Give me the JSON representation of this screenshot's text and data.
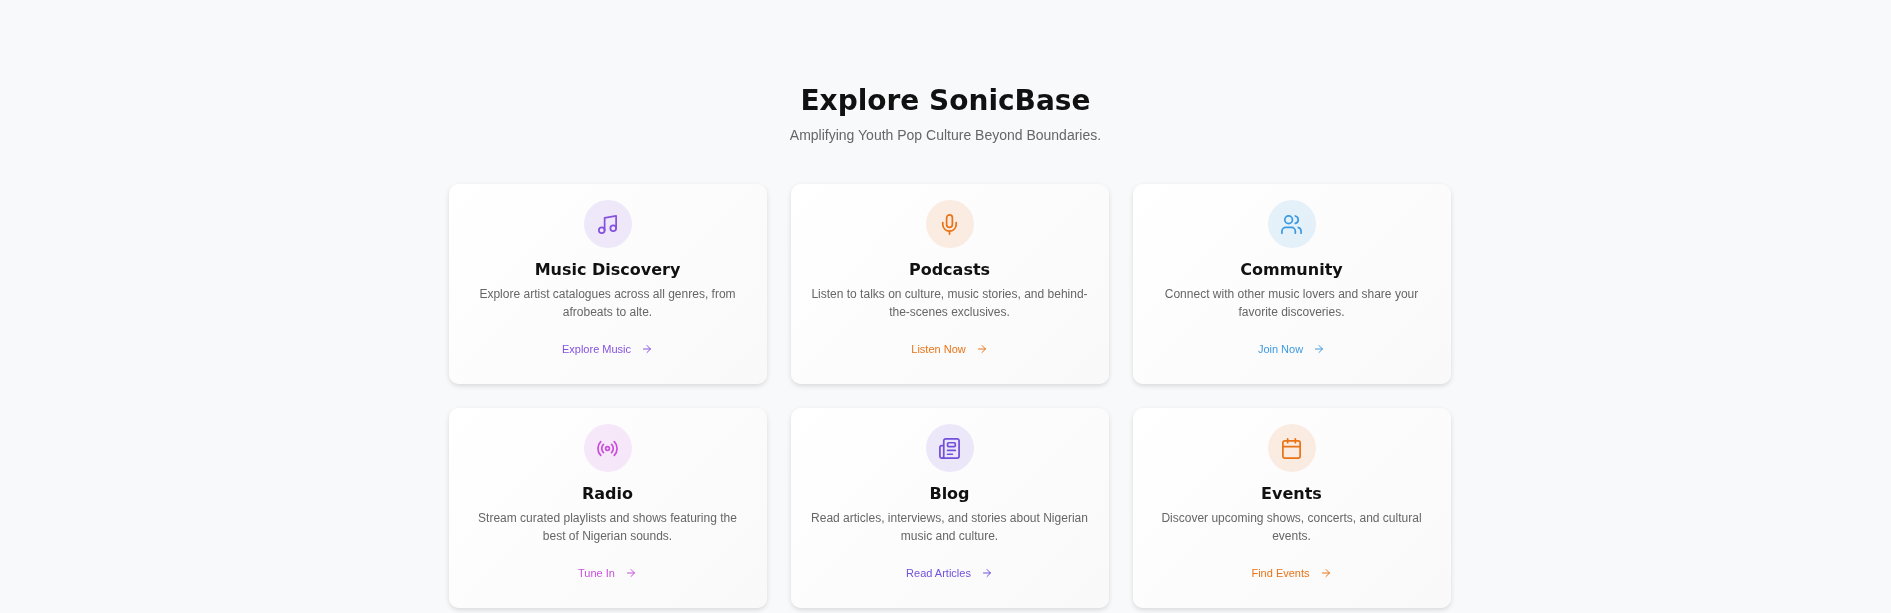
{
  "header": {
    "title": "Explore SonicBase",
    "subtitle": "Amplifying Youth Pop Culture Beyond Boundaries."
  },
  "cards": [
    {
      "title": "Music Discovery",
      "description": "Explore artist catalogues across all genres, from afrobeats to alte.",
      "link": "Explore Music",
      "color": "#8552e0"
    },
    {
      "title": "Podcasts",
      "description": "Listen to talks on culture, music stories, and behind-the-scenes exclusives.",
      "link": "Listen Now",
      "color": "#ea7317"
    },
    {
      "title": "Community",
      "description": "Connect with other music lovers and share your favorite discoveries.",
      "link": "Join Now",
      "color": "#3b9ae1"
    },
    {
      "title": "Radio",
      "description": "Stream curated playlists and shows featuring the best of Nigerian sounds.",
      "link": "Tune In",
      "color": "#c84fdb"
    },
    {
      "title": "Blog",
      "description": "Read articles, interviews, and stories about Nigerian music and culture.",
      "link": "Read Articles",
      "color": "#7350dc"
    },
    {
      "title": "Events",
      "description": "Discover upcoming shows, concerts, and cultural events.",
      "link": "Find Events",
      "color": "#ea7317"
    }
  ]
}
